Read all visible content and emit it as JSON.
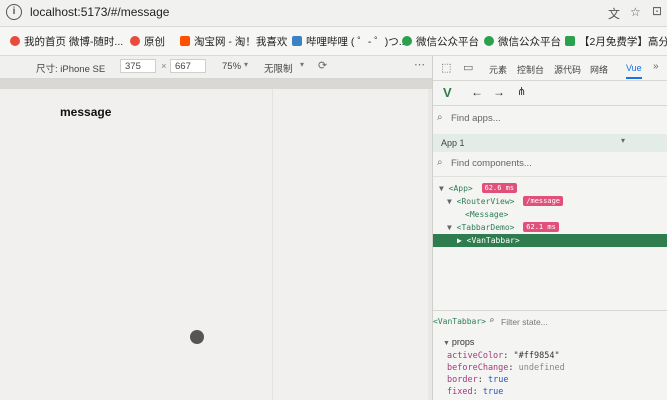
{
  "browser": {
    "url": "localhost:5173/#/message",
    "bookmarks": [
      {
        "label": "我的首页 微博-随时...",
        "color": "#e74c3c"
      },
      {
        "label": "原创",
        "color": "#e74c3c"
      },
      {
        "label": "淘宝网 - 淘！我喜欢",
        "color": "#ff5000"
      },
      {
        "label": "哔哩哔哩 ( ゜- ゜)つ...",
        "color": "#3b82c4"
      },
      {
        "label": "微信公众平台",
        "color": "#2aa14c"
      },
      {
        "label": "微信公众平台",
        "color": "#2aa14c"
      },
      {
        "label": "【2月免费学】高分...",
        "color": "#2aa14c"
      }
    ]
  },
  "device_toolbar": {
    "device_label": "尺寸: iPhone SE",
    "width": "375",
    "times": "×",
    "height": "667",
    "zoom": "75%",
    "throttle": "无限制"
  },
  "page": {
    "heading": "message"
  },
  "devtools": {
    "tabs": [
      "元素",
      "控制台",
      "源代码",
      "网络",
      "Vue"
    ],
    "active_tab": "Vue",
    "find_apps_placeholder": "Find apps...",
    "app_label": "App 1",
    "find_components_placeholder": "Find components...",
    "tree": [
      {
        "name": "<App>",
        "badge": "62.6 ms",
        "indent": 0,
        "arrow": "▼"
      },
      {
        "name": "<RouterView>",
        "badge": "/message",
        "indent": 1,
        "arrow": "▼"
      },
      {
        "name": "<Message>",
        "badge": "",
        "indent": 2,
        "arrow": ""
      },
      {
        "name": "<TabbarDemo>",
        "badge": "62.1 ms",
        "indent": 1,
        "arrow": "▼"
      },
      {
        "name": "<VanTabbar>",
        "badge": "",
        "indent": 2,
        "arrow": "▶",
        "selected": true
      }
    ],
    "selected_component": "<VanTabbar>",
    "filter_placeholder": "Filter state...",
    "props_header": "props",
    "props": [
      {
        "key": "activeColor",
        "value": "\"#ff9854\""
      },
      {
        "key": "beforeChange",
        "value": "undefined"
      },
      {
        "key": "border",
        "value": "true"
      },
      {
        "key": "fixed",
        "value": "true"
      }
    ]
  },
  "colors": {
    "vue_green": "#2f7d4e",
    "badge_pink": "#e0507a"
  }
}
